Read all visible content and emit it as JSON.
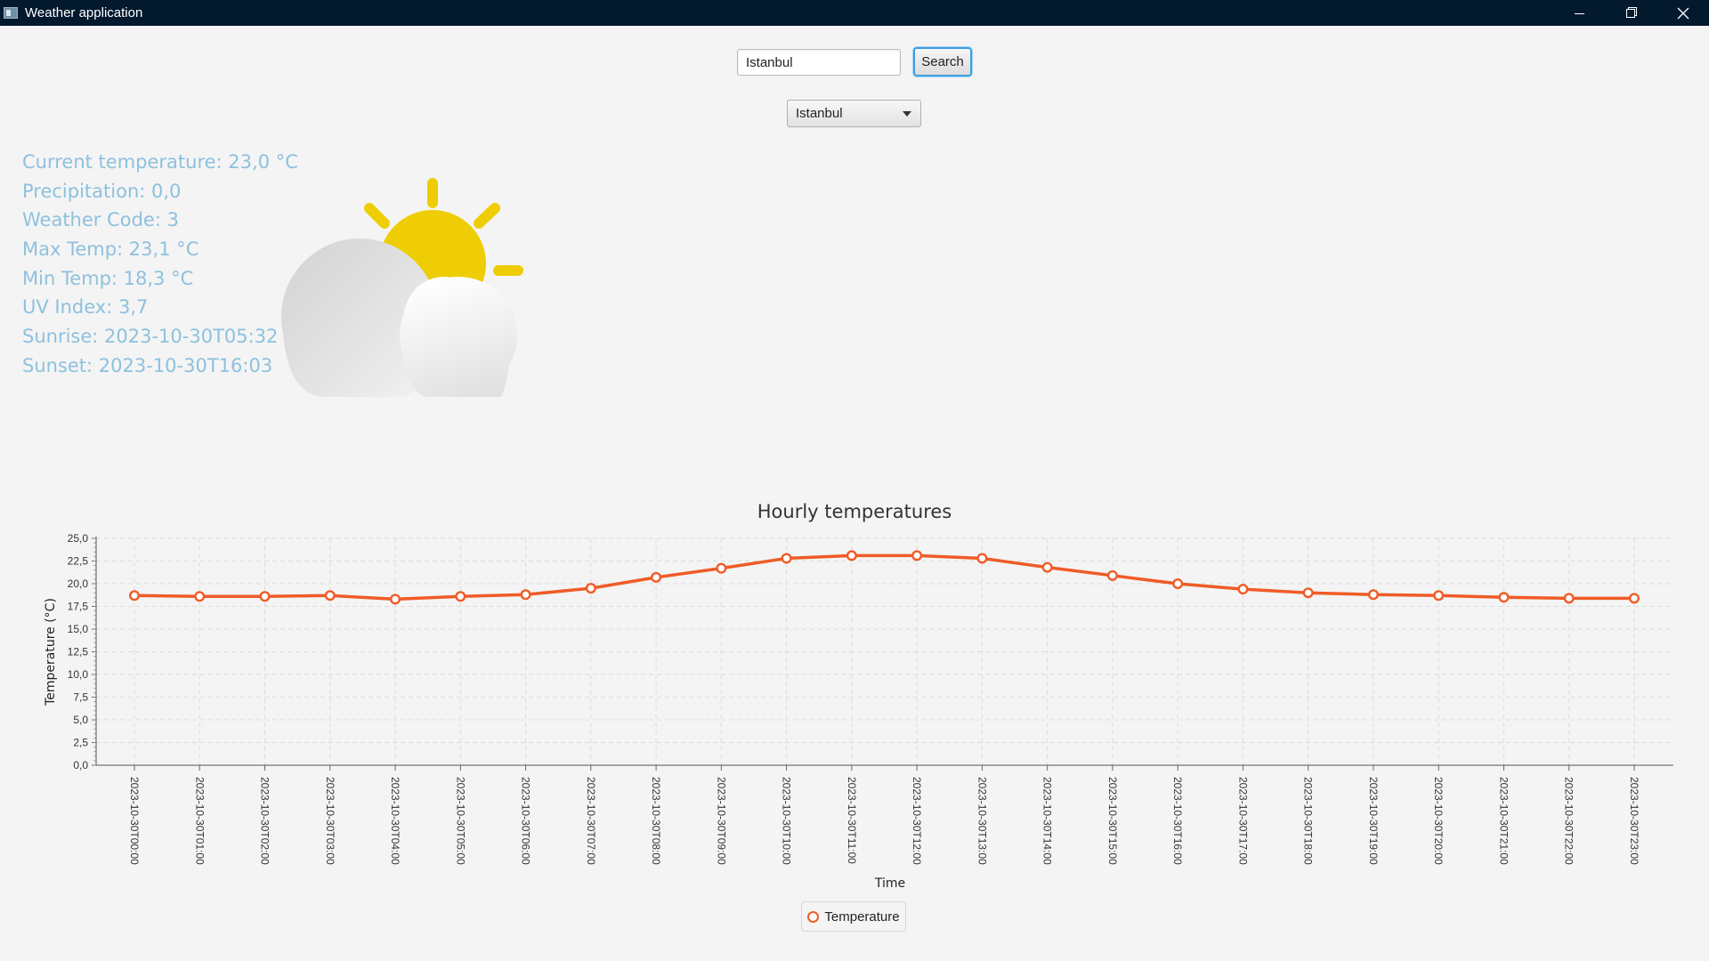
{
  "window": {
    "title": "Weather application",
    "controls": [
      "minimize",
      "restore",
      "close"
    ]
  },
  "search": {
    "value": "Istanbul",
    "button_label": "Search"
  },
  "city_select": {
    "selected": "Istanbul"
  },
  "info": {
    "current_temperature": "Current temperature: 23,0 °C",
    "precipitation": "Precipitation: 0,0",
    "weather_code": "Weather Code: 3",
    "max_temp": "Max Temp: 23,1 °C",
    "min_temp": "Min Temp: 18,3 °C",
    "uv_index": "UV Index: 3,7",
    "sunrise": "Sunrise: 2023-10-30T05:32",
    "sunset": "Sunset: 2023-10-30T16:03"
  },
  "weather_icon": "partly-cloudy-icon",
  "colors": {
    "accent": "#3c9fe0",
    "info_text": "#8dc1de",
    "series_line": "#f05b27",
    "sun": "#eecd05",
    "titlebar": "#03192e"
  },
  "chart_data": {
    "type": "line",
    "title": "Hourly temperatures",
    "xlabel": "Time",
    "ylabel": "Temperature (°C)",
    "ylim": [
      0,
      25
    ],
    "y_ticks": [
      "0,0",
      "2,5",
      "5,0",
      "7,5",
      "10,0",
      "12,5",
      "15,0",
      "17,5",
      "20,0",
      "22,5",
      "25,0"
    ],
    "grid": true,
    "legend": "bottom-center",
    "categories": [
      "2023-10-30T00:00",
      "2023-10-30T01:00",
      "2023-10-30T02:00",
      "2023-10-30T03:00",
      "2023-10-30T04:00",
      "2023-10-30T05:00",
      "2023-10-30T06:00",
      "2023-10-30T07:00",
      "2023-10-30T08:00",
      "2023-10-30T09:00",
      "2023-10-30T10:00",
      "2023-10-30T11:00",
      "2023-10-30T12:00",
      "2023-10-30T13:00",
      "2023-10-30T14:00",
      "2023-10-30T15:00",
      "2023-10-30T16:00",
      "2023-10-30T17:00",
      "2023-10-30T18:00",
      "2023-10-30T19:00",
      "2023-10-30T20:00",
      "2023-10-30T21:00",
      "2023-10-30T22:00",
      "2023-10-30T23:00"
    ],
    "series": [
      {
        "name": "Temperature",
        "values": [
          18.7,
          18.6,
          18.6,
          18.7,
          18.3,
          18.6,
          18.8,
          19.5,
          20.7,
          21.7,
          22.8,
          23.1,
          23.1,
          22.8,
          21.8,
          20.9,
          20.0,
          19.4,
          19.0,
          18.8,
          18.7,
          18.5,
          18.4,
          18.4
        ]
      }
    ]
  }
}
